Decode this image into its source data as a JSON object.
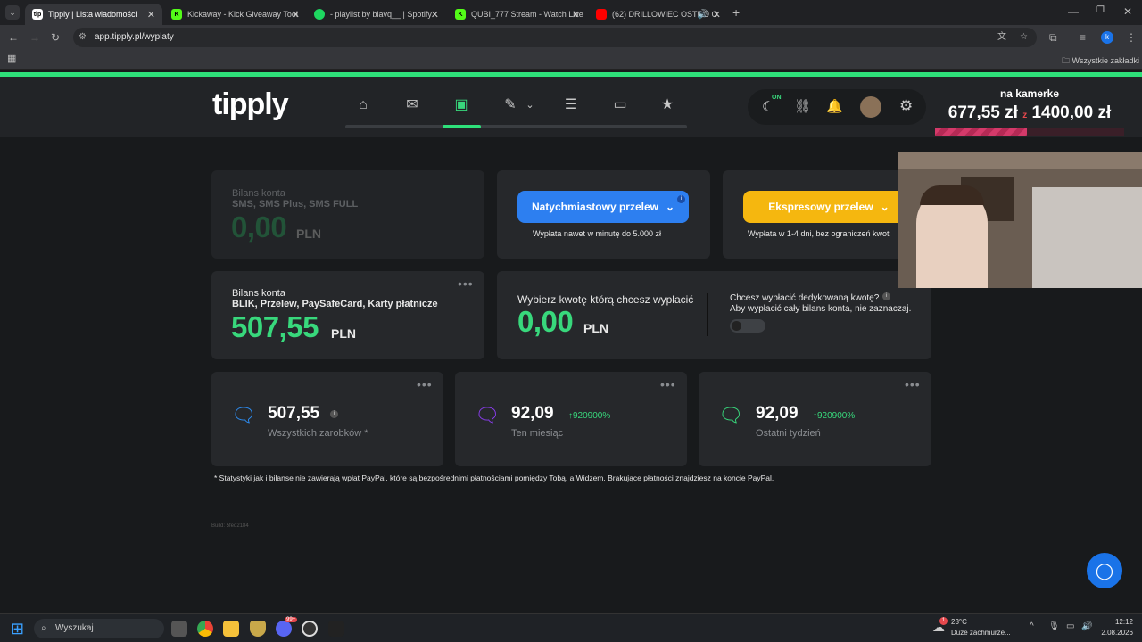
{
  "browser": {
    "tabs": [
      {
        "title": "Tipply | Lista wiadomości",
        "active": true,
        "favicon_color": "#ffffff"
      },
      {
        "title": "Kickaway - Kick Giveaway Tool",
        "active": false,
        "favicon_color": "#53fc18"
      },
      {
        "title": "- playlist by blavq__ | Spotify",
        "active": false,
        "favicon_color": "#1ed760"
      },
      {
        "title": "QUBI_777 Stream - Watch Live",
        "active": false,
        "favicon_color": "#53fc18"
      },
      {
        "title": "(62) DRILLOWIEC OSTRO O",
        "active": false,
        "favicon_color": "#ff0000"
      }
    ],
    "url": "app.tipply.pl/wyplaty",
    "bookmarks_all": "Wszystkie zakładki",
    "profile_initial": "k"
  },
  "header": {
    "logo": "tipply",
    "on_badge": "ON"
  },
  "overlay": {
    "title": "na kamerke",
    "current": "677,55 zł",
    "separator": "z",
    "goal": "1400,00 zł",
    "progress": 0.484
  },
  "balance_sms": {
    "title": "Bilans konta",
    "subtitle": "SMS, SMS Plus, SMS FULL",
    "amount": "0,00",
    "currency": "PLN"
  },
  "instant": {
    "button": "Natychmiastowy przelew",
    "note": "Wypłata nawet w minutę do 5.000 zł"
  },
  "express": {
    "button": "Ekspresowy przelew",
    "note": "Wypłata w 1-4 dni, bez ograniczeń kwot"
  },
  "balance_main": {
    "title": "Bilans konta",
    "subtitle": "BLIK, Przelew, PaySafeCard, Karty płatnicze",
    "amount": "507,55",
    "currency": "PLN"
  },
  "withdraw": {
    "label": "Wybierz kwotę którą chcesz wypłacić",
    "amount": "0,00",
    "currency": "PLN",
    "dedicated_q": "Chcesz wypłacić dedykowaną kwotę?",
    "dedicated_hint": "Aby wypłacić cały bilans konta, nie zaznaczaj."
  },
  "stats": [
    {
      "value": "507,55",
      "label": "Wszystkich zarobków *",
      "pct": "",
      "icon_color": "#2d8cf0"
    },
    {
      "value": "92,09",
      "label": "Ten miesiąc",
      "pct": "↑920900%",
      "icon_color": "#8b3df0"
    },
    {
      "value": "92,09",
      "label": "Ostatni tydzień",
      "pct": "↑920900%",
      "icon_color": "#38d87c"
    }
  ],
  "footnote": "* Statystyki jak i bilanse nie zawierają wpłat PayPal, które są bezpośrednimi płatnościami pomiędzy Tobą, a Widzem. Brakujące płatności znajdziesz na koncie PayPal.",
  "build": "Build: 5fed2184",
  "taskbar": {
    "search": "Wyszukaj",
    "weather_temp": "23°C",
    "weather_desc": "Duże zachmurze...",
    "time": "12:12",
    "date": "2.08.2026",
    "notification_count": "1",
    "discord_badge": "99+"
  }
}
